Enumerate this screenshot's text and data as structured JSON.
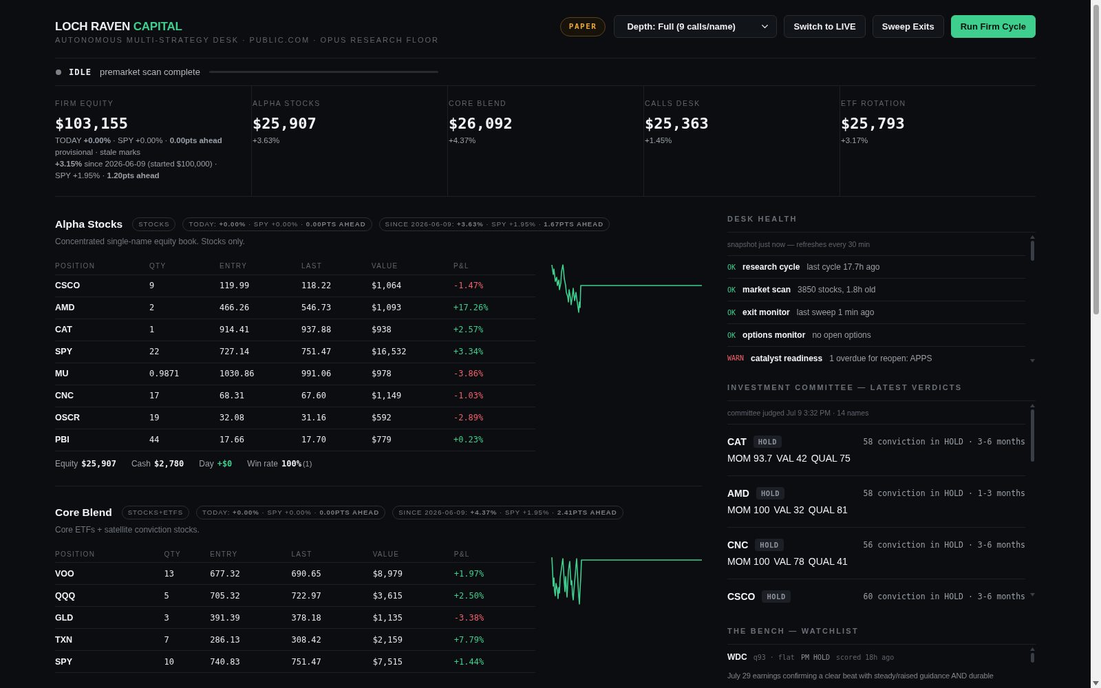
{
  "header": {
    "brand": {
      "name": "LOCH RAVEN",
      "accent": "CAPITAL"
    },
    "subtitle": "AUTONOMOUS MULTI-STRATEGY DESK · PUBLIC.COM · OPUS RESEARCH FLOOR",
    "mode_badge": "PAPER",
    "depth_select": {
      "value": "Depth: Full (9 calls/name)"
    },
    "buttons": [
      {
        "label": "Switch to LIVE",
        "kind": "secondary"
      },
      {
        "label": "Sweep Exits",
        "kind": "secondary"
      },
      {
        "label": "Run Firm Cycle",
        "kind": "primary"
      }
    ]
  },
  "status": {
    "kind": "idle",
    "state": "IDLE",
    "message": "premarket scan complete",
    "level": 0
  },
  "summary": [
    {
      "label": "FIRM EQUITY",
      "value": "$103,155",
      "lines": [
        "TODAY **+0.00%** · SPY +0.00% · **0.00pts ahead**",
        "provisional · stale marks",
        "**+3.15%** since 2026-06-09 (started $100,000) · SPY +1.95% · **1.20pts ahead**"
      ]
    },
    {
      "label": "ALPHA STOCKS",
      "value": "$25,907",
      "lines": [
        "+3.63%"
      ]
    },
    {
      "label": "CORE BLEND",
      "value": "$26,092",
      "lines": [
        "+4.37%"
      ]
    },
    {
      "label": "CALLS DESK",
      "value": "$25,363",
      "lines": [
        "+1.45%"
      ]
    },
    {
      "label": "ETF ROTATION",
      "value": "$25,793",
      "lines": [
        "+3.17%"
      ]
    }
  ],
  "books": [
    {
      "name": "Alpha Stocks",
      "tag": "STOCKS",
      "pills": [
        "TODAY: **+0.00%** · SPY +0.00% · **0.00PTS AHEAD**",
        "SINCE 2026-06-09: **+3.63%** · SPY +1.95% · **1.67PTS AHEAD**"
      ],
      "description": "Concentrated single-name equity book. Stocks only.",
      "columns": [
        "POSITION",
        "QTY",
        "ENTRY",
        "LAST",
        "VALUE",
        "P&L"
      ],
      "rows": [
        {
          "symbol": "CSCO",
          "qty": "9",
          "entry": "119.99",
          "last": "118.22",
          "value": "$1,064",
          "pnl": "-1.47%",
          "loss": true
        },
        {
          "symbol": "AMD",
          "qty": "2",
          "entry": "466.26",
          "last": "546.73",
          "value": "$1,093",
          "pnl": "+17.26%",
          "loss": false
        },
        {
          "symbol": "CAT",
          "qty": "1",
          "entry": "914.41",
          "last": "937.88",
          "value": "$938",
          "pnl": "+2.57%",
          "loss": false
        },
        {
          "symbol": "SPY",
          "qty": "22",
          "entry": "727.14",
          "last": "751.47",
          "value": "$16,532",
          "pnl": "+3.34%",
          "loss": false
        },
        {
          "symbol": "MU",
          "qty": "0.9871",
          "entry": "1030.86",
          "last": "991.06",
          "value": "$978",
          "pnl": "-3.86%",
          "loss": true
        },
        {
          "symbol": "CNC",
          "qty": "17",
          "entry": "68.31",
          "last": "67.60",
          "value": "$1,149",
          "pnl": "-1.03%",
          "loss": true
        },
        {
          "symbol": "OSCR",
          "qty": "19",
          "entry": "32.08",
          "last": "31.16",
          "value": "$592",
          "pnl": "-2.89%",
          "loss": true
        },
        {
          "symbol": "PBI",
          "qty": "44",
          "entry": "17.66",
          "last": "17.70",
          "value": "$779",
          "pnl": "+0.23%",
          "loss": false
        }
      ],
      "footer": [
        {
          "label": "Equity",
          "value": "$25,907",
          "gain": false
        },
        {
          "label": "Cash",
          "value": "$2,780",
          "gain": false
        },
        {
          "label": "Day",
          "value": "+$0",
          "gain": true
        },
        {
          "label": "Win rate",
          "value": "100%",
          "note": "(1)",
          "gain": false
        }
      ]
    },
    {
      "name": "Core Blend",
      "tag": "STOCKS+ETFS",
      "pills": [
        "TODAY: **+0.00%** · SPY +0.00% · **0.00PTS AHEAD**",
        "SINCE 2026-06-09: **+4.37%** · SPY +1.95% · **2.41PTS AHEAD**"
      ],
      "description": "Core ETFs + satellite conviction stocks.",
      "columns": [
        "POSITION",
        "QTY",
        "ENTRY",
        "LAST",
        "VALUE",
        "P&L"
      ],
      "rows": [
        {
          "symbol": "VOO",
          "qty": "13",
          "entry": "677.32",
          "last": "690.65",
          "value": "$8,979",
          "pnl": "+1.97%",
          "loss": false
        },
        {
          "symbol": "QQQ",
          "qty": "5",
          "entry": "705.32",
          "last": "722.97",
          "value": "$3,615",
          "pnl": "+2.50%",
          "loss": false
        },
        {
          "symbol": "GLD",
          "qty": "3",
          "entry": "391.39",
          "last": "378.18",
          "value": "$1,135",
          "pnl": "-3.38%",
          "loss": true
        },
        {
          "symbol": "TXN",
          "qty": "7",
          "entry": "286.13",
          "last": "308.42",
          "value": "$2,159",
          "pnl": "+7.79%",
          "loss": false
        },
        {
          "symbol": "SPY",
          "qty": "10",
          "entry": "740.83",
          "last": "751.47",
          "value": "$7,515",
          "pnl": "+1.44%",
          "loss": false
        }
      ]
    }
  ],
  "desk_health": {
    "title": "DESK HEALTH",
    "note": "snapshot just now — refreshes every 30 min",
    "items": [
      {
        "status": "OK",
        "kind": "ok",
        "name": "research cycle",
        "detail": "last cycle 17.7h ago"
      },
      {
        "status": "OK",
        "kind": "ok",
        "name": "market scan",
        "detail": "3850 stocks, 1.8h old"
      },
      {
        "status": "OK",
        "kind": "ok",
        "name": "exit monitor",
        "detail": "last sweep 1 min ago"
      },
      {
        "status": "OK",
        "kind": "ok",
        "name": "options monitor",
        "detail": "no open options"
      },
      {
        "status": "WARN",
        "kind": "warn",
        "name": "catalyst readiness",
        "detail": "1 overdue for reopen: APPS"
      }
    ]
  },
  "committee": {
    "title": "INVESTMENT COMMITTEE — LATEST VERDICTS",
    "note": "committee judged Jul 9 3:32 PM · 14 names",
    "verdicts": [
      {
        "symbol": "CAT",
        "verdict": "HOLD",
        "summary": "58 conviction in HOLD · 3-6 months",
        "scores": [
          "MOM 93.7",
          "VAL 42",
          "QUAL 75"
        ]
      },
      {
        "symbol": "AMD",
        "verdict": "HOLD",
        "summary": "58 conviction in HOLD · 1-3 months",
        "scores": [
          "MOM 100",
          "VAL 32",
          "QUAL 81"
        ]
      },
      {
        "symbol": "CNC",
        "verdict": "HOLD",
        "summary": "56 conviction in HOLD · 3-6 months",
        "scores": [
          "MOM 100",
          "VAL 78",
          "QUAL 41"
        ]
      },
      {
        "symbol": "CSCO",
        "verdict": "HOLD",
        "summary": "60 conviction in HOLD · 3-6 months"
      }
    ]
  },
  "bench": {
    "title": "THE BENCH — WATCHLIST",
    "items": [
      {
        "symbol": "WDC",
        "meta": "q93 · flat",
        "verdict": "PM HOLD",
        "age": "scored 18h ago",
        "note": "July 29 earnings confirming a clear beat with steady/raised guidance AND durable"
      }
    ]
  }
}
